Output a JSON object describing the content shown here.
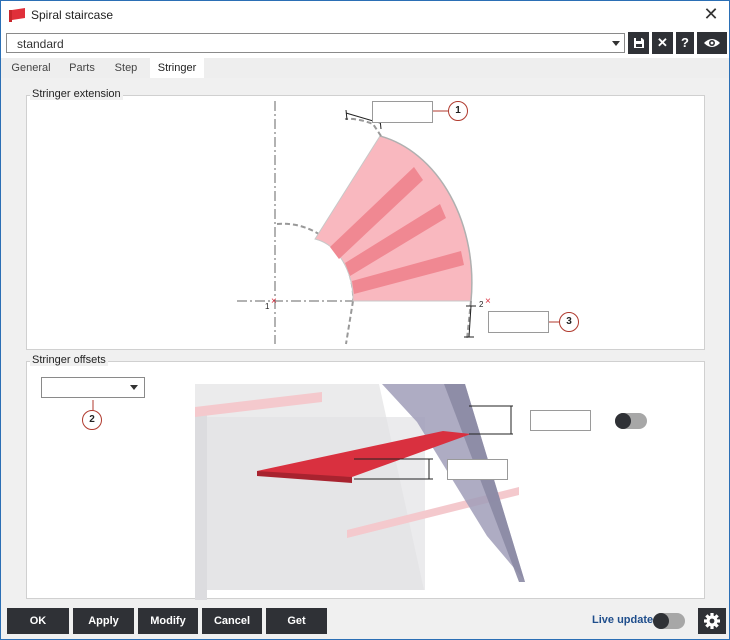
{
  "window": {
    "title": "Spiral staircase"
  },
  "profile": {
    "value": "standard"
  },
  "toolbar": {
    "save_icon": "save-icon",
    "delete_label": "✕",
    "help_label": "?",
    "eye_icon": "eye-icon"
  },
  "tabs": [
    {
      "label": "General"
    },
    {
      "label": "Parts"
    },
    {
      "label": "Step"
    },
    {
      "label": "Stringer"
    }
  ],
  "active_tab": "Stringer",
  "stringer_extension": {
    "label": "Stringer extension",
    "field_1_value": "",
    "field_3_value": "",
    "callout_1": "1",
    "callout_3": "3",
    "point_1": "1",
    "point_2": "2"
  },
  "stringer_offsets": {
    "label": "Stringer offsets",
    "dropdown_value": "",
    "callout_2": "2",
    "top_offset_value": "",
    "bottom_offset_value": "",
    "offset_toggle_on": false
  },
  "footer": {
    "ok": "OK",
    "apply": "Apply",
    "modify": "Modify",
    "cancel": "Cancel",
    "get": "Get",
    "live_update": "Live update",
    "live_update_on": false
  },
  "colors": {
    "accent_dark": "#2f3136",
    "highlight_red": "#d9303f",
    "callout_red": "#b03a2e",
    "link_blue": "#1f4e8c"
  }
}
